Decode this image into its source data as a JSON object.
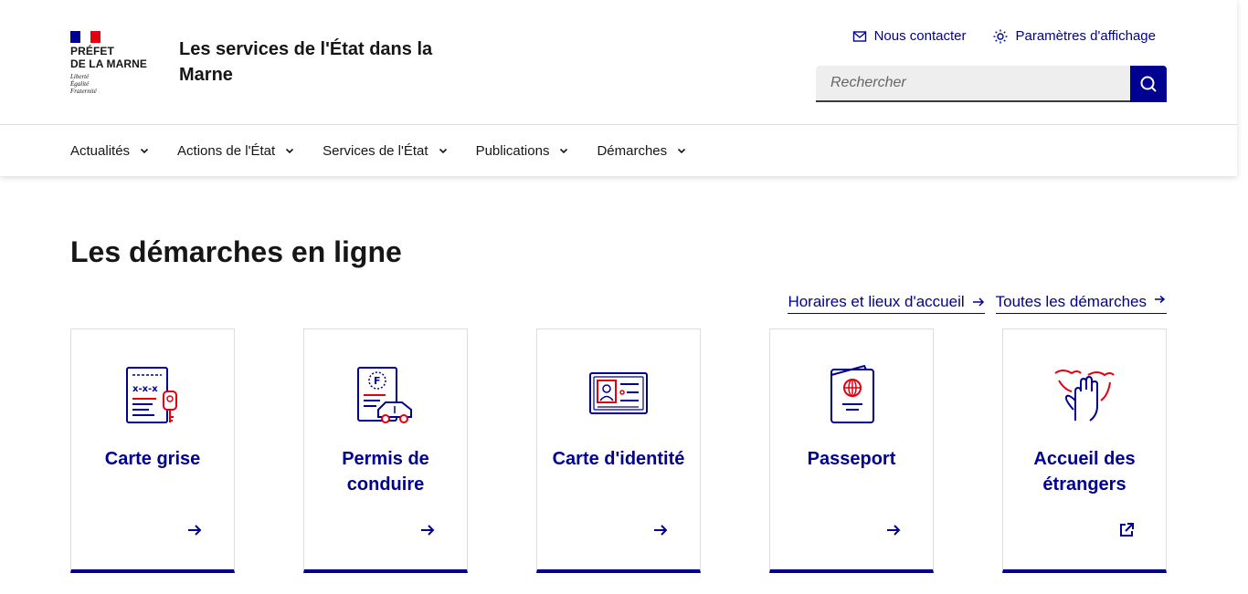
{
  "header": {
    "logo": {
      "line1": "PRÉFET",
      "line2": "DE LA MARNE",
      "motto1": "Liberté",
      "motto2": "Égalité",
      "motto3": "Fraternité"
    },
    "service_title": "Les services de l'État dans la Marne",
    "tools": {
      "contact": "Nous contacter",
      "display": "Paramètres d'affichage"
    },
    "search": {
      "placeholder": "Rechercher"
    }
  },
  "nav": {
    "items": [
      {
        "label": "Actualités"
      },
      {
        "label": "Actions de l'État"
      },
      {
        "label": "Services de l'État"
      },
      {
        "label": "Publications"
      },
      {
        "label": "Démarches"
      }
    ]
  },
  "main": {
    "title": "Les démarches en ligne",
    "links": {
      "hours": "Horaires et lieux d'accueil",
      "all": "Toutes les démarches"
    },
    "cards": [
      {
        "title": "Carte grise",
        "icon": "car-registration-icon",
        "link": "arrow-right-icon"
      },
      {
        "title": "Permis de conduire",
        "icon": "driving-licence-icon",
        "link": "arrow-right-icon"
      },
      {
        "title": "Carte d'identité",
        "icon": "id-card-icon",
        "link": "arrow-right-icon"
      },
      {
        "title": "Passeport",
        "icon": "passport-icon",
        "link": "arrow-right-icon"
      },
      {
        "title": "Accueil des étrangers",
        "icon": "welcome-hands-icon",
        "link": "external-link-icon"
      }
    ]
  },
  "colors": {
    "primary": "#000091",
    "red": "#e1000f",
    "border": "#dddddd"
  }
}
